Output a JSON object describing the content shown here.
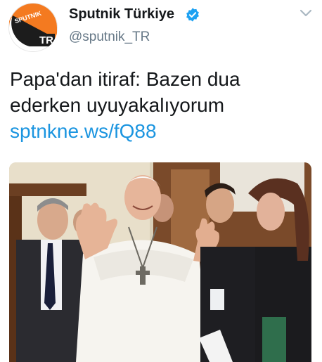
{
  "account": {
    "display_name": "Sputnik Türkiye",
    "handle": "@sputnik_TR",
    "avatar": {
      "logo_text": "SPUTNIK",
      "badge_text": "TR",
      "brand_color": "#f47a20"
    },
    "verified_icon": "verified-badge-icon"
  },
  "tweet": {
    "text_line1": "Papa'dan itiraf: Bazen dua",
    "text_line2": "ederken uyuyakalıyorum",
    "link": "sptnkne.ws/fQ88"
  },
  "menu": {
    "icon": "chevron-down-icon"
  },
  "media": {
    "type": "photo"
  },
  "colors": {
    "link": "#1b95e0",
    "verified": "#1da1f2",
    "text": "#14171a",
    "secondary": "#657786"
  }
}
